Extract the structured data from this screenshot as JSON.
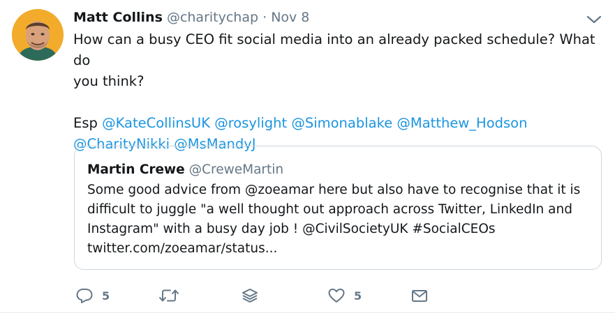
{
  "tweet": {
    "author_name": "Matt Collins",
    "author_handle": "@charitychap",
    "separator": "·",
    "date": "Nov 8",
    "text_line1": "How can a busy CEO fit social media into an already packed schedule? What do",
    "text_line2": "you think?",
    "esp_prefix": "Esp",
    "mentions_line1": [
      "@KateCollinsUK",
      "@rosylight",
      "@Simonablake",
      "@Matthew_Hodson"
    ],
    "mentions_line2": [
      "@CharityNikki",
      "@MsMandyJ"
    ]
  },
  "quote": {
    "author_name": "Martin Crewe",
    "author_handle": "@CreweMartin",
    "lines": [
      "Some good advice from @zoeamar here but also have to recognise that it is",
      "difficult to juggle \"a well thought out approach across Twitter, LinkedIn and",
      "Instagram\" with a busy day job ! @CivilSocietyUK #SocialCEOs",
      "twitter.com/zoeamar/status..."
    ]
  },
  "actions": {
    "reply_count": "5",
    "like_count": "5"
  },
  "icons": {
    "reply": "reply-icon",
    "retweet": "retweet-icon",
    "stack": "stack-icon",
    "like": "heart-icon",
    "message": "envelope-icon",
    "caret": "chevron-down-icon"
  },
  "colors": {
    "link": "#1b95e0",
    "secondary": "#657786",
    "text": "#14171a",
    "icon": "#657786",
    "border": "#ccd6dd"
  }
}
